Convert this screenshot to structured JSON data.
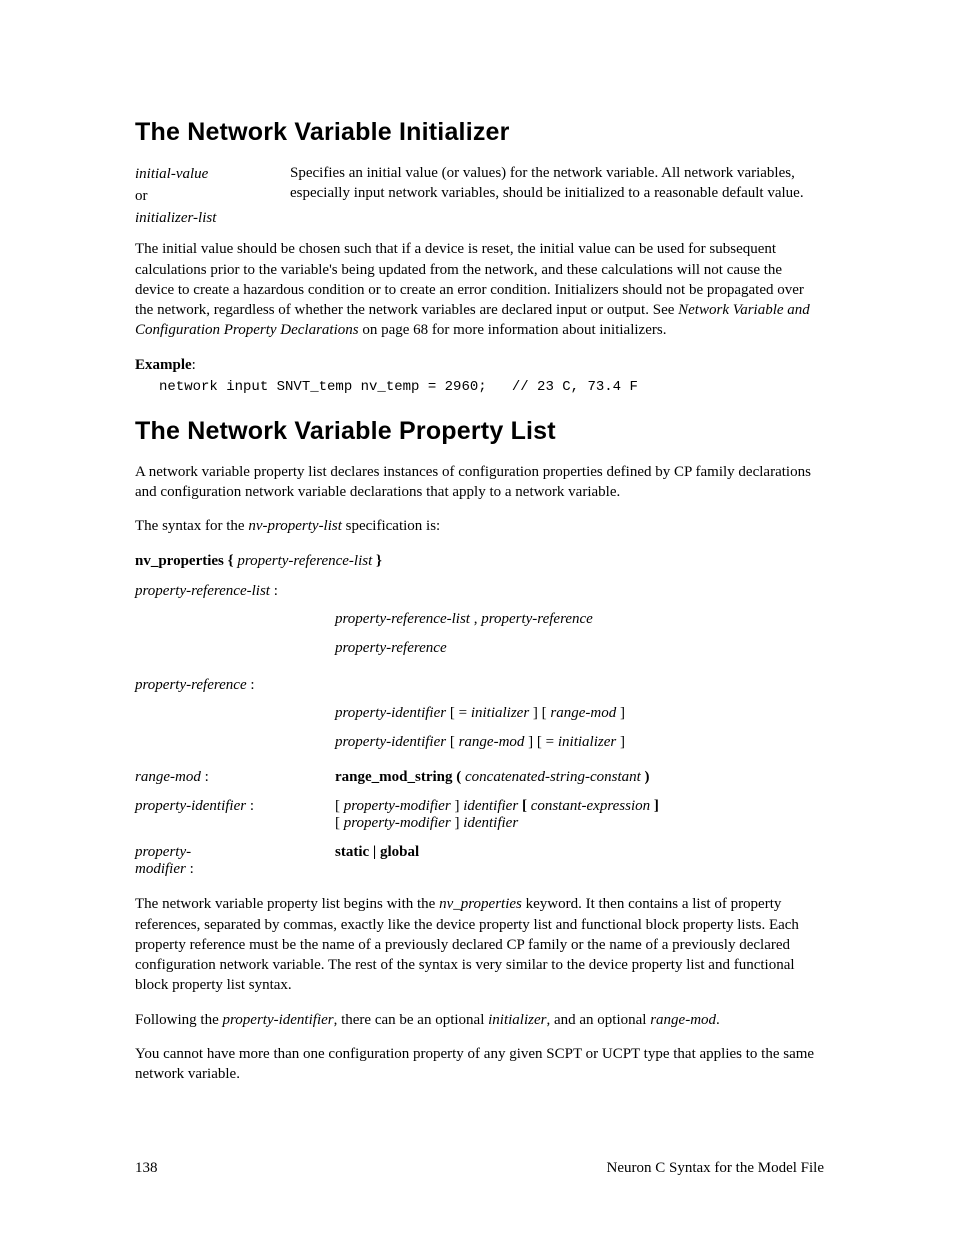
{
  "section1": {
    "heading": "The Network Variable Initializer",
    "term_left_1": "initial-value",
    "term_left_or": "or",
    "term_left_2": "initializer-list",
    "term_desc": "Specifies an initial value (or values) for the network variable.  All network variables, especially input network variables, should be initialized to a reasonable default value.",
    "para1_a": "The initial value should be chosen such that if a device is reset, the initial value can be used for subsequent calculations prior to the variable's being updated from the network, and these calculations will not cause the device to create a hazardous condition or to create an error condition.  Initializers should not be propagated over the network, regardless of whether the network variables are declared input or output.  See ",
    "para1_link": "Network Variable and Configuration Property Declarations",
    "para1_b": " on page 68 for more information about initializers.",
    "example_label": "Example",
    "example_colon": ":",
    "codeline": "network input SNVT_temp nv_temp = 2960;   // 23 C, 73.4 F"
  },
  "section2": {
    "heading": "The Network Variable Property List",
    "para1": "A network variable property list declares instances of configuration properties defined by CP family declarations and configuration network variable declarations that apply to a network variable.",
    "para2_a": "The syntax for the ",
    "para2_em": "nv-property-list",
    "para2_b": " specification is:",
    "syntax1_bold": "nv_properties {",
    "syntax1_em": " property-reference-list ",
    "syntax1_close": "}",
    "prl_label": "property-reference-list",
    "prl_colon": " :",
    "prl_line1_a": "property-reference-list ",
    "prl_line1_comma": ",",
    "prl_line1_b": " property-reference",
    "prl_line2": "property-reference",
    "pr_label": "property-reference",
    "pr_colon": " :",
    "pr_line1_a": "property-identifier  ",
    "pr_line1_b1": "[",
    "pr_line1_eq": " = ",
    "pr_line1_init": "initializer ",
    "pr_line1_b2": "]",
    "pr_line1_sp": "  ",
    "pr_line1_b3": "[",
    "pr_line1_rm": " range-mod ",
    "pr_line1_b4": "]",
    "pr_line2_a": "property-identifier  ",
    "pr_line2_b1": "[",
    "pr_line2_rm": " range-mod ",
    "pr_line2_b2": "]",
    "pr_line2_sp": "  ",
    "pr_line2_b3": "[",
    "pr_line2_eq": " = ",
    "pr_line2_init": "initializer ",
    "pr_line2_b4": "]",
    "rm_label": "range-mod",
    "rm_colon": " :",
    "rm_bold": "range_mod_string (",
    "rm_em": " concatenated-string-constant ",
    "rm_close": ")",
    "pi_label": "property-identifier",
    "pi_colon": " :",
    "pi_line1_b1": "[",
    "pi_line1_pm": " property-modifier ",
    "pi_line1_b2": "]",
    "pi_line1_id": " identifier ",
    "pi_line1_b3": "[",
    "pi_line1_ce": " constant-expression ",
    "pi_line1_b4": "]",
    "pi_line2_b1": "[",
    "pi_line2_pm": " property-modifier ",
    "pi_line2_b2": "]",
    "pi_line2_id": " identifier",
    "pm_label": "property-modifier",
    "pm_colon": " :",
    "pm_val": "static  |  global",
    "para3_a": "The network variable property list begins with the ",
    "para3_em": "nv_properties",
    "para3_b": " keyword.  It then contains a list of property references, separated by commas, exactly like the device property list and functional block property lists.  Each property reference must be the name of a previously declared CP family or the name of a previously declared configuration network variable.  The rest of the syntax is very similar to the device property list and functional block property list syntax.",
    "para4_a": "Following the ",
    "para4_em1": "property-identifier",
    "para4_b": ", there can be an optional ",
    "para4_em2": "initializer",
    "para4_c": ", and an optional ",
    "para4_em3": "range-mod",
    "para4_d": ".",
    "para5": "You cannot have more than one configuration property of any given SCPT or UCPT type that applies to the same network variable."
  },
  "footer": {
    "page_number": "138",
    "doc_title": "Neuron C Syntax for the Model File"
  }
}
